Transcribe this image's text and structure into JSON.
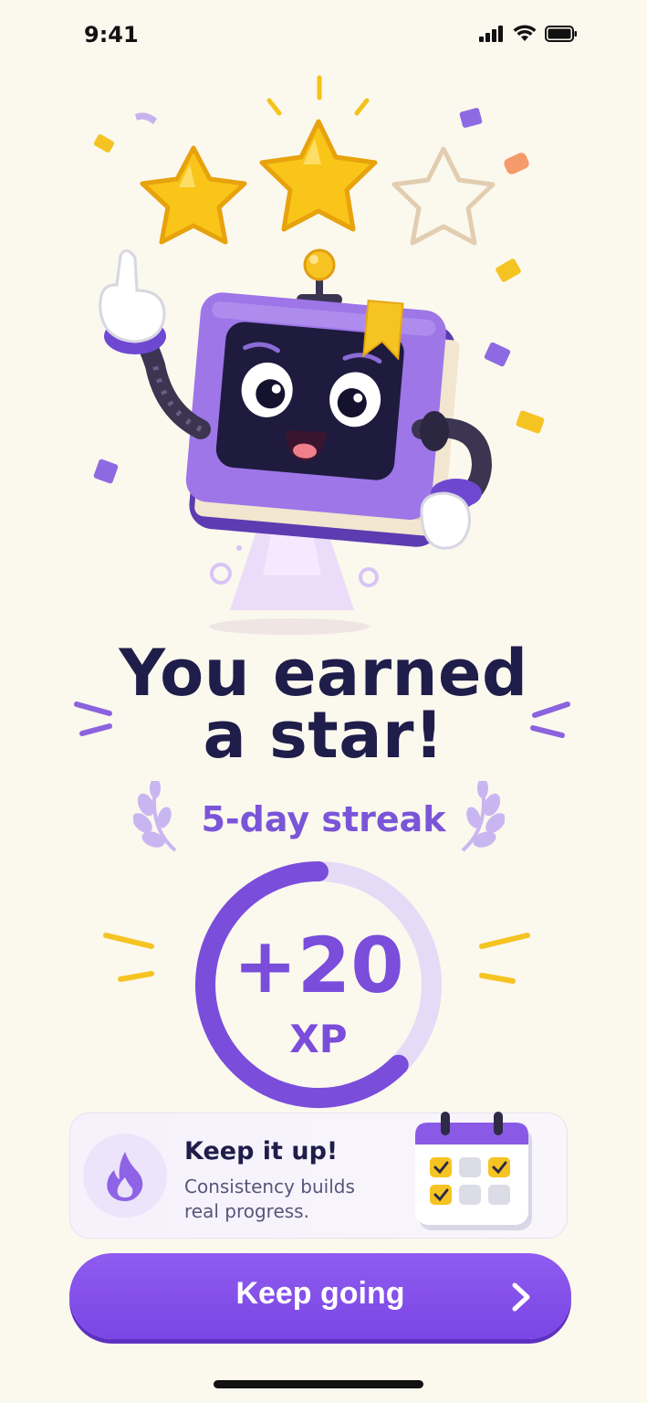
{
  "status_bar": {
    "time": "9:41"
  },
  "rating": {
    "stars_earned": 2,
    "stars_total": 3
  },
  "title": {
    "line1": "You earned",
    "line2": "a star!"
  },
  "streak": {
    "label": "5-day streak"
  },
  "xp": {
    "amount": "+20",
    "unit": "XP"
  },
  "card": {
    "title": "Keep it up!",
    "body": "Consistency builds real progress."
  },
  "cta": {
    "label": "Keep going"
  },
  "icons": [
    "signal-icon",
    "wifi-icon",
    "battery-icon",
    "flame-icon",
    "calendar-icon",
    "chevron-right-icon",
    "laurel-icon"
  ],
  "colors": {
    "accent": "#7A4DDB",
    "background": "#FBF8EE",
    "title": "#1F1D4A",
    "star": "#F7C21A"
  }
}
